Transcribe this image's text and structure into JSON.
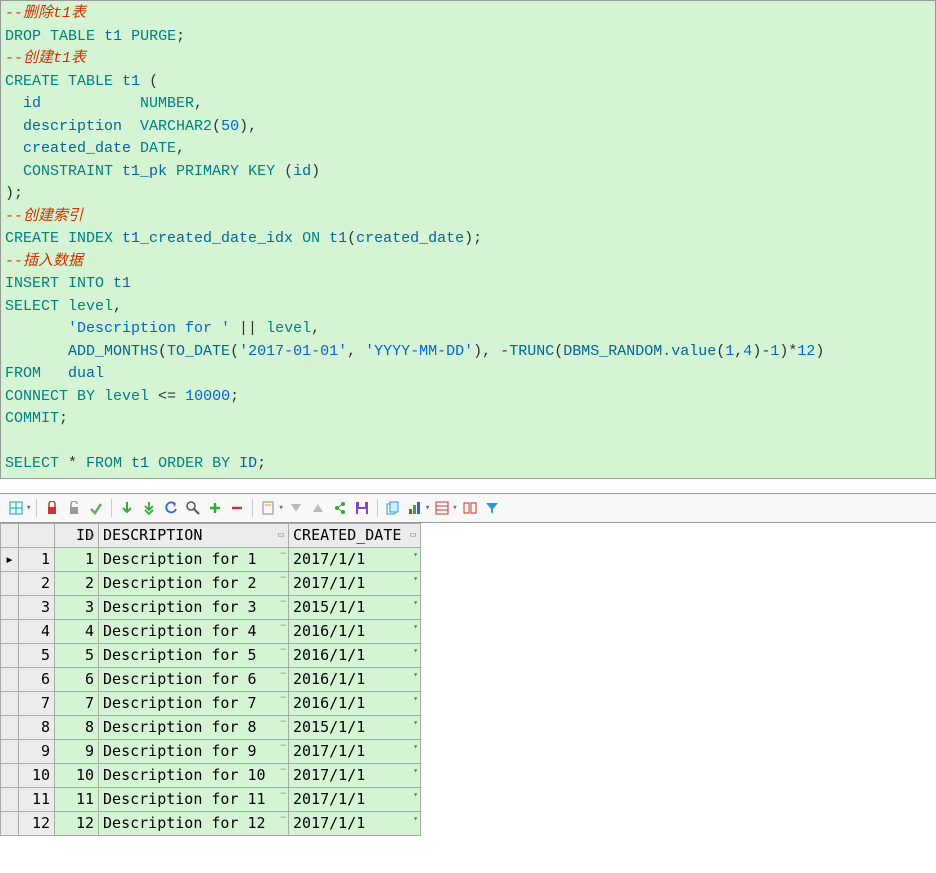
{
  "code": {
    "c1": "--删除t1表",
    "l2_drop": "DROP",
    "l2_table": "TABLE",
    "l2_t1": "t1",
    "l2_purge": "PURGE",
    "l2_semi": ";",
    "c2": "--创建t1表",
    "l4_create": "CREATE",
    "l4_table": "TABLE",
    "l4_t1": "t1",
    "l4_op": " (",
    "l5_id": "  id           ",
    "l5_num": "NUMBER",
    "l5_c": ",",
    "l6_desc": "  description  ",
    "l6_vc": "VARCHAR2",
    "l6_o": "(",
    "l6_n": "50",
    "l6_cl": "),",
    "l7_cd": "  created_date ",
    "l7_date": "DATE",
    "l7_c": ",",
    "l8_con": "  CONSTRAINT",
    "l8_pk": " t1_pk ",
    "l8_pri": "PRIMARY",
    "l8_key": " KEY",
    "l8_op": " (",
    "l8_id": "id",
    "l8_cl": ")",
    "l9": ");",
    "c3": "--创建索引",
    "l11_create": "CREATE",
    "l11_index": " INDEX",
    "l11_name": " t1_created_date_idx ",
    "l11_on": "ON",
    "l11_t1": " t1",
    "l11_op": "(",
    "l11_cd": "created_date",
    "l11_cl": ");",
    "c4": "--插入数据",
    "l13_ins": "INSERT",
    "l13_into": " INTO",
    "l13_t1": " t1",
    "l14_sel": "SELECT",
    "l14_lvl": " level",
    "l14_c": ",",
    "l15_sp": "       ",
    "l15_str": "'Description for '",
    "l15_pipe": " || ",
    "l15_lvl": "level",
    "l15_c": ",",
    "l16_sp": "       ",
    "l16_am": "ADD_MONTHS",
    "l16_o": "(",
    "l16_td": "TO_DATE",
    "l16_o2": "(",
    "l16_s1": "'2017-01-01'",
    "l16_c1": ", ",
    "l16_s2": "'YYYY-MM-DD'",
    "l16_cl1": "), ",
    "l16_neg": "-",
    "l16_tr": "TRUNC",
    "l16_o3": "(",
    "l16_db": "DBMS_RANDOM.value",
    "l16_o4": "(",
    "l16_n1": "1",
    "l16_c2": ",",
    "l16_n4": "4",
    "l16_cl2": ")",
    "l16_m1": "-",
    "l16_n1b": "1",
    "l16_cl3": ")",
    "l16_mul": "*",
    "l16_n12": "12",
    "l16_cl4": ")",
    "l17_from": "FROM",
    "l17_dual": "   dual",
    "l18_con": "CONNECT",
    "l18_by": " BY",
    "l18_lvl": " level",
    "l18_op": " <= ",
    "l18_n": "10000",
    "l18_s": ";",
    "l19": "COMMIT",
    "l19_s": ";",
    "l21_sel": "SELECT",
    "l21_star": " * ",
    "l21_from": "FROM",
    "l21_t1": " t1 ",
    "l21_ord": "ORDER",
    "l21_by": " BY",
    "l21_id": " ID",
    "l21_s": ";"
  },
  "toolbar": {
    "icons": [
      "grid",
      "lock",
      "lock2",
      "check",
      "down-green",
      "up-green",
      "undo",
      "find",
      "plus",
      "minus",
      "page",
      "tri-down",
      "tri-up",
      "link",
      "save",
      "db",
      "bars",
      "table",
      "tables",
      "funnel"
    ]
  },
  "columns": {
    "id": "ID",
    "desc": "DESCRIPTION",
    "date": "CREATED_DATE"
  },
  "rows": [
    {
      "n": "1",
      "id": "1",
      "desc": "Description for 1",
      "date": "2017/1/1"
    },
    {
      "n": "2",
      "id": "2",
      "desc": "Description for 2",
      "date": "2017/1/1"
    },
    {
      "n": "3",
      "id": "3",
      "desc": "Description for 3",
      "date": "2015/1/1"
    },
    {
      "n": "4",
      "id": "4",
      "desc": "Description for 4",
      "date": "2016/1/1"
    },
    {
      "n": "5",
      "id": "5",
      "desc": "Description for 5",
      "date": "2016/1/1"
    },
    {
      "n": "6",
      "id": "6",
      "desc": "Description for 6",
      "date": "2016/1/1"
    },
    {
      "n": "7",
      "id": "7",
      "desc": "Description for 7",
      "date": "2016/1/1"
    },
    {
      "n": "8",
      "id": "8",
      "desc": "Description for 8",
      "date": "2015/1/1"
    },
    {
      "n": "9",
      "id": "9",
      "desc": "Description for 9",
      "date": "2017/1/1"
    },
    {
      "n": "10",
      "id": "10",
      "desc": "Description for 10",
      "date": "2017/1/1"
    },
    {
      "n": "11",
      "id": "11",
      "desc": "Description for 11",
      "date": "2017/1/1"
    },
    {
      "n": "12",
      "id": "12",
      "desc": "Description for 12",
      "date": "2017/1/1"
    }
  ],
  "marker": "▸"
}
